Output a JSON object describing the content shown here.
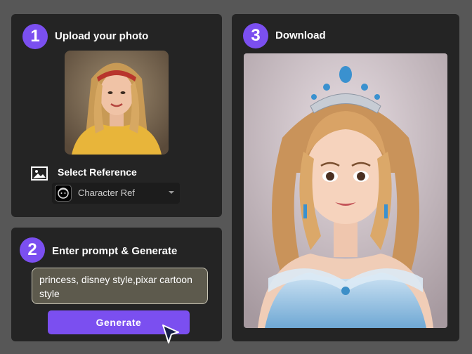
{
  "step1": {
    "number": "1",
    "title": "Upload your photo",
    "reference_label": "Select Reference",
    "dropdown_value": "Character Ref"
  },
  "step2": {
    "number": "2",
    "title": "Enter prompt & Generate",
    "prompt_text": "princess, disney style,pixar cartoon style",
    "button_label": "Generate"
  },
  "step3": {
    "number": "3",
    "title": "Download"
  },
  "colors": {
    "accent": "#7b4ff0",
    "panel": "#242424",
    "background": "#575757"
  },
  "icons": [
    "image-icon",
    "caret-down-icon",
    "cursor-arrow-icon"
  ]
}
